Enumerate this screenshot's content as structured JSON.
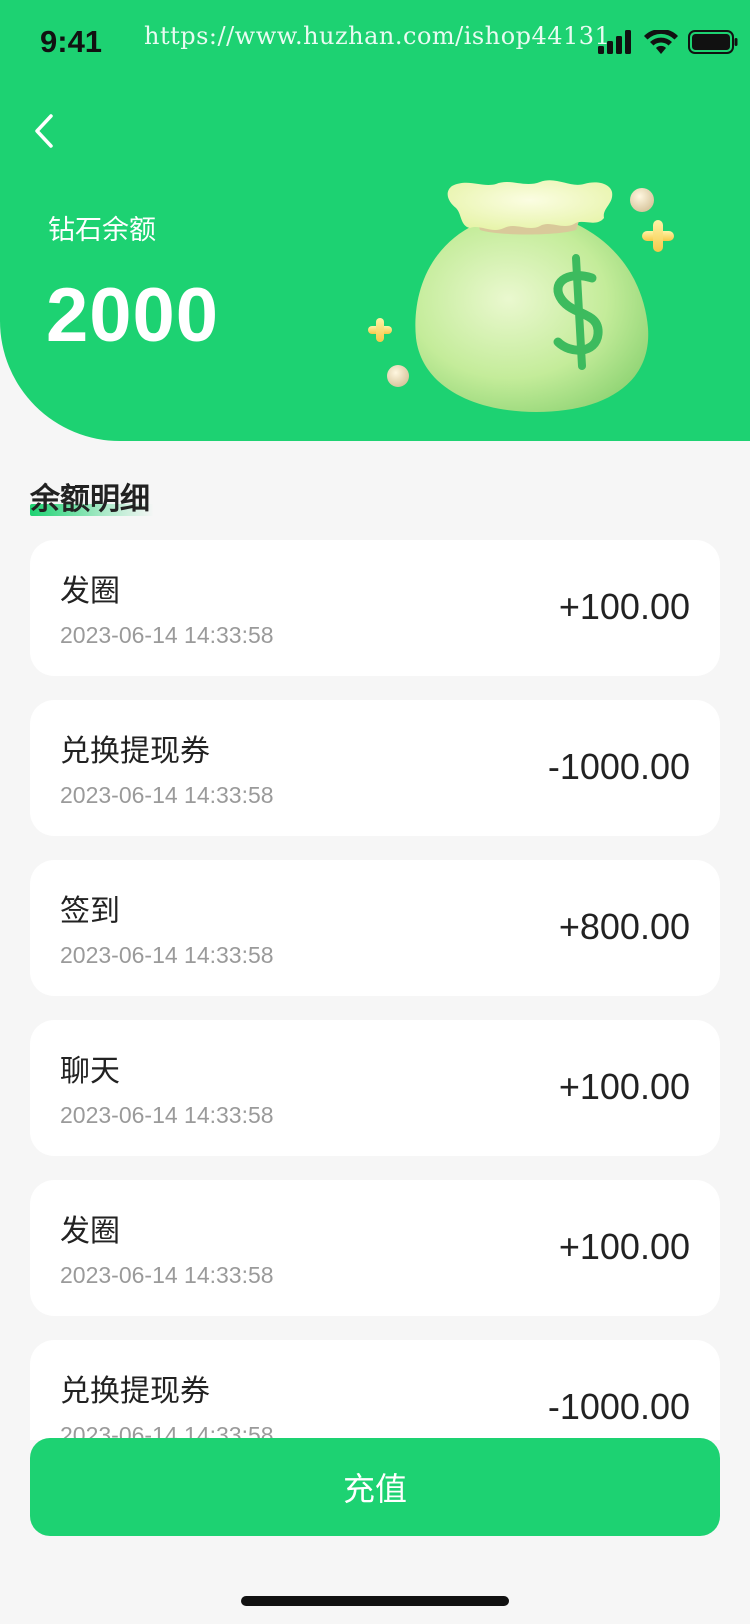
{
  "status_bar": {
    "time": "9:41",
    "url": "https://www.huzhan.com/ishop44131",
    "icons": [
      "cellular-signal-icon",
      "wifi-icon",
      "battery-icon"
    ]
  },
  "header": {
    "back_icon": "chevron-left-icon",
    "balance_label": "钻石余额",
    "balance_value": "2000",
    "illustration": "money-bag-icon",
    "background_color": "#1dd272"
  },
  "section": {
    "title": "余额明细"
  },
  "transactions": [
    {
      "title": "发圈",
      "time": "2023-06-14 14:33:58",
      "amount": "+100.00"
    },
    {
      "title": "兑换提现券",
      "time": "2023-06-14 14:33:58",
      "amount": "-1000.00"
    },
    {
      "title": "签到",
      "time": "2023-06-14 14:33:58",
      "amount": "+800.00"
    },
    {
      "title": "聊天",
      "time": "2023-06-14 14:33:58",
      "amount": "+100.00"
    },
    {
      "title": "发圈",
      "time": "2023-06-14 14:33:58",
      "amount": "+100.00"
    },
    {
      "title": "兑换提现券",
      "time": "2023-06-14 14:33:58",
      "amount": "-1000.00"
    }
  ],
  "footer": {
    "recharge_label": "充值"
  },
  "colors": {
    "accent": "#1dd272",
    "background": "#f6f6f6",
    "muted_text": "#9a9a9a"
  }
}
